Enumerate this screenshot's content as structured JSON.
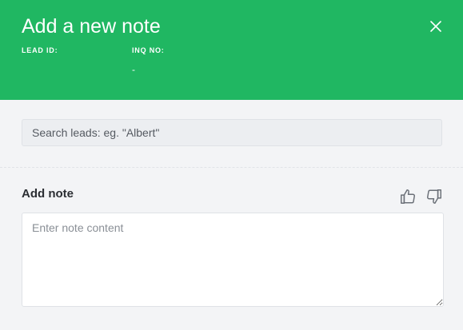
{
  "modal": {
    "title": "Add a new note",
    "close_icon": "close-icon"
  },
  "lead": {
    "lead_id_label": "LEAD ID:",
    "lead_id_value": "",
    "inq_no_label": "INQ NO:",
    "inq_no_value": "-"
  },
  "search": {
    "placeholder": "Search leads: eg. \"Albert\"",
    "value": ""
  },
  "note": {
    "label": "Add note",
    "placeholder": "Enter note content",
    "value": "",
    "thumbs_up_icon": "thumbs-up-icon",
    "thumbs_down_icon": "thumbs-down-icon"
  },
  "colors": {
    "header_bg": "#20b762",
    "page_bg": "#f3f4f6",
    "icon_gray": "#6b7078"
  }
}
